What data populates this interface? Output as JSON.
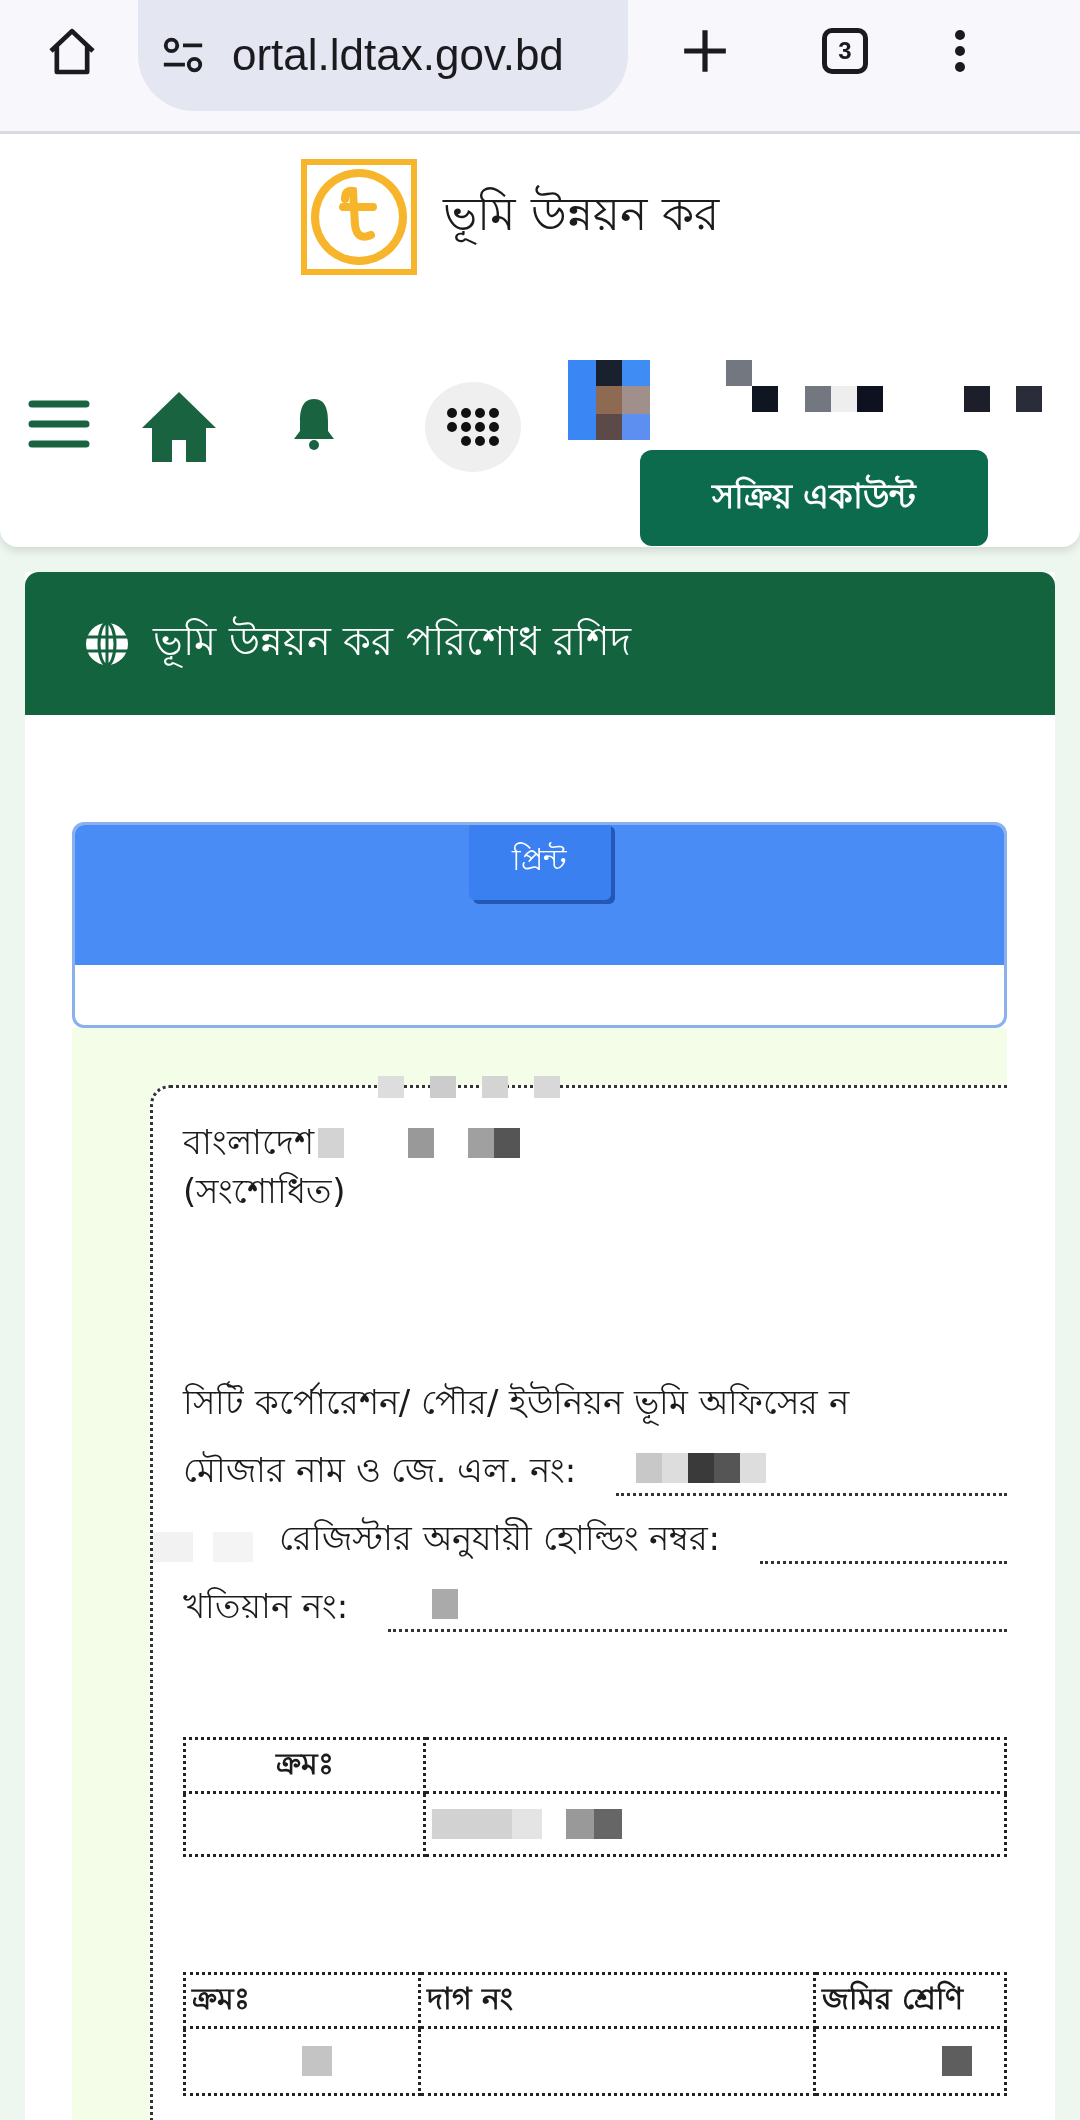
{
  "browser": {
    "url": "ortal.ldtax.gov.bd",
    "tab_count": "3"
  },
  "header": {
    "site_title": "ভূমি উন্নয়ন কর",
    "account_button": "সক্রিয় একাউন্ট"
  },
  "card": {
    "title": "ভূমি উন্নয়ন কর পরিশোধ রশিদ",
    "print_button": "প্রিন্ট"
  },
  "receipt": {
    "heading_lines": [
      "বাংলাদেশ",
      "(সংশোধিত)"
    ],
    "fields": [
      {
        "label": "সিটি কর্পোরেশন/ পৌর/ ইউনিয়ন ভূমি অফিসের ন",
        "kind": "plain"
      },
      {
        "label": "মৌজার নাম ও জে. এল. নং:",
        "kind": "blank"
      },
      {
        "label": "রেজিস্টার অনুযায়ী হোল্ডিং নম্বর:",
        "kind": "redacted-blank"
      },
      {
        "label": "খতিয়ান নং:",
        "kind": "blank"
      }
    ],
    "table_1": {
      "columns": [
        "ক্রমঃ"
      ]
    },
    "table_2": {
      "columns": [
        "ক্রমঃ",
        "দাগ নং",
        "জমির শ্রেণি"
      ]
    }
  }
}
